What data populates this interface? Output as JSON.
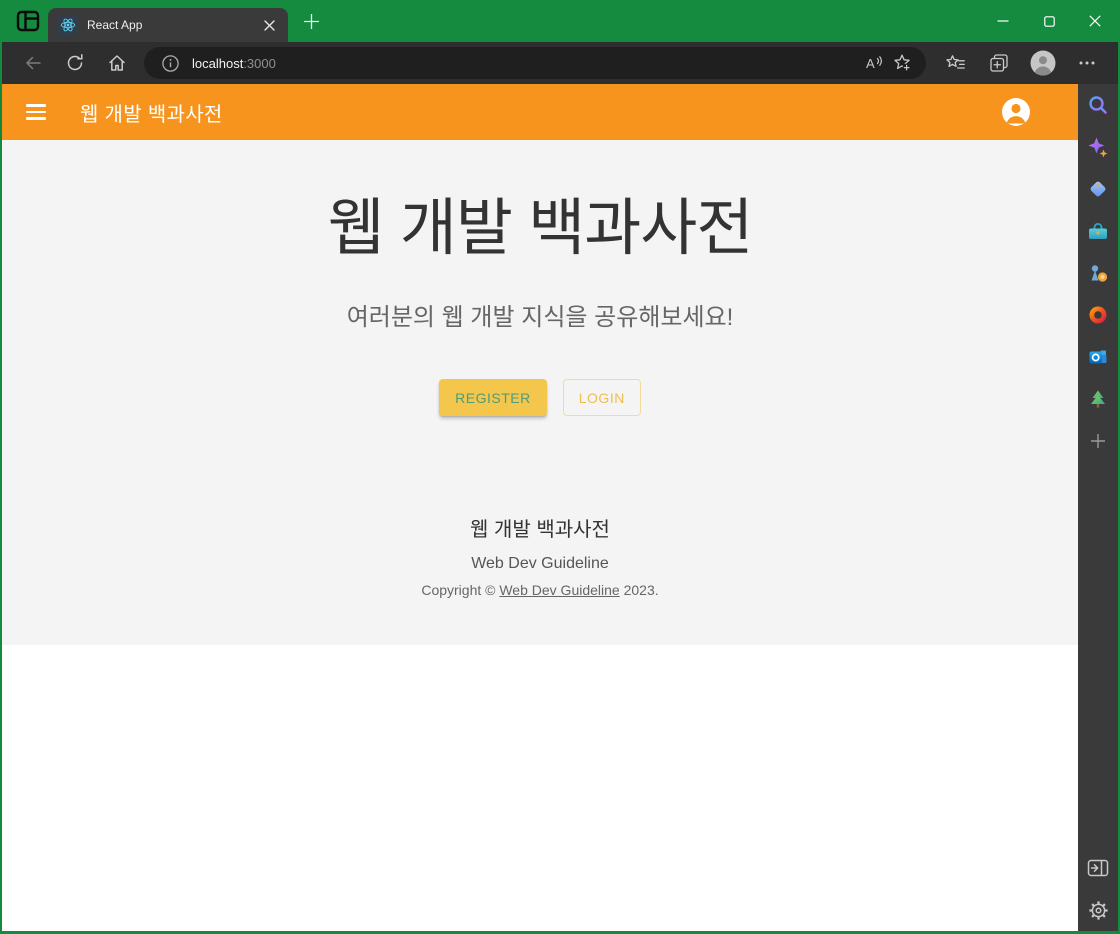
{
  "browser": {
    "tab_title": "React App",
    "url": {
      "host": "localhost",
      "port": ":3000"
    },
    "more_glyph": "…"
  },
  "app_bar": {
    "title": "웹 개발 백과사전"
  },
  "hero": {
    "title": "웹 개발 백과사전",
    "subtitle": "여러분의 웹 개발 지식을 공유해보세요!",
    "register_label": "REGISTER",
    "login_label": "LOGIN"
  },
  "footer": {
    "site_name": "웹 개발 백과사전",
    "team_name": "Web Dev Guideline",
    "copyright_prefix": "Copyright © ",
    "copyright_link": "Web Dev Guideline",
    "copyright_suffix": " 2023."
  },
  "sidebar_icons": [
    "search-icon",
    "copilot-icon",
    "shopping-tag-icon",
    "toolbox-icon",
    "games-icon",
    "office-icon",
    "outlook-icon",
    "tree-icon",
    "add-sidebar-item-icon",
    "open-in-sidebar-icon",
    "settings-icon"
  ],
  "colors": {
    "frame_green": "#148B3F",
    "navbar_bg": "#2E2E2E",
    "addressbar_bg": "#1F1F1F",
    "tab_bg": "#3A3A3A",
    "sidebar_bg": "#3A3A3A",
    "appbar_orange": "#F6941E",
    "hero_bg": "#F4F4F4",
    "register_bg_amber": "#F4C64C",
    "register_text_green": "#4F9C77",
    "login_text_amber": "#EDBE52",
    "react_cyan": "#5FD4F4"
  }
}
